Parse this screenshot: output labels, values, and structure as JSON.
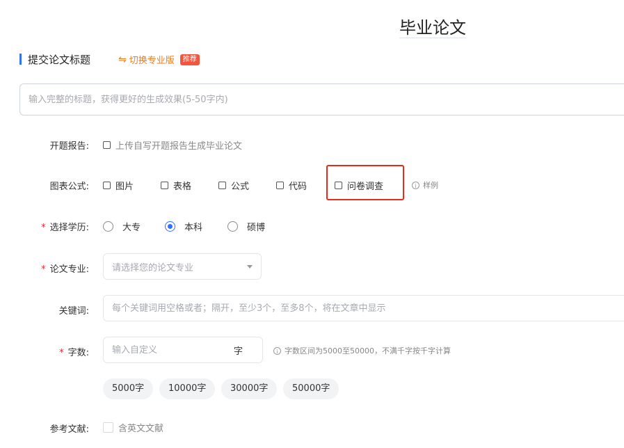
{
  "page_title": "毕业论文",
  "section": {
    "title": "提交论文标题",
    "switch_label": "切换专业版",
    "switch_badge": "推荐"
  },
  "title_input": {
    "placeholder": "输入完整的标题，获得更好的生成效果(5-50字内)"
  },
  "opening_report": {
    "label": "开题报告:",
    "checkbox_label": "上传自写开题报告生成毕业论文"
  },
  "charts": {
    "label": "图表公式:",
    "options": [
      "图片",
      "表格",
      "公式",
      "代码",
      "问卷调查"
    ],
    "example_label": "样例"
  },
  "education": {
    "label": "选择学历:",
    "options": [
      "大专",
      "本科",
      "硕博"
    ],
    "selected": "本科"
  },
  "major": {
    "label": "论文专业:",
    "placeholder": "请选择您的论文专业"
  },
  "keywords": {
    "label": "关键词:",
    "placeholder": "每个关键词用空格或者；隔开，至少3个，至多8个，将在文章中显示"
  },
  "word_count": {
    "label": "字数:",
    "placeholder": "输入自定义",
    "unit": "字",
    "hint": "字数区间为5000至50000，不满千字按千字计算",
    "presets": [
      "5000字",
      "10000字",
      "30000字",
      "50000字"
    ]
  },
  "references": {
    "label": "参考文献:",
    "checkbox_label": "含英文文献"
  },
  "colors": {
    "accent": "#3370ff",
    "orange": "#f07c1b",
    "badge": "#f5553c",
    "highlight": "#e8291c",
    "required": "#f5222d"
  }
}
